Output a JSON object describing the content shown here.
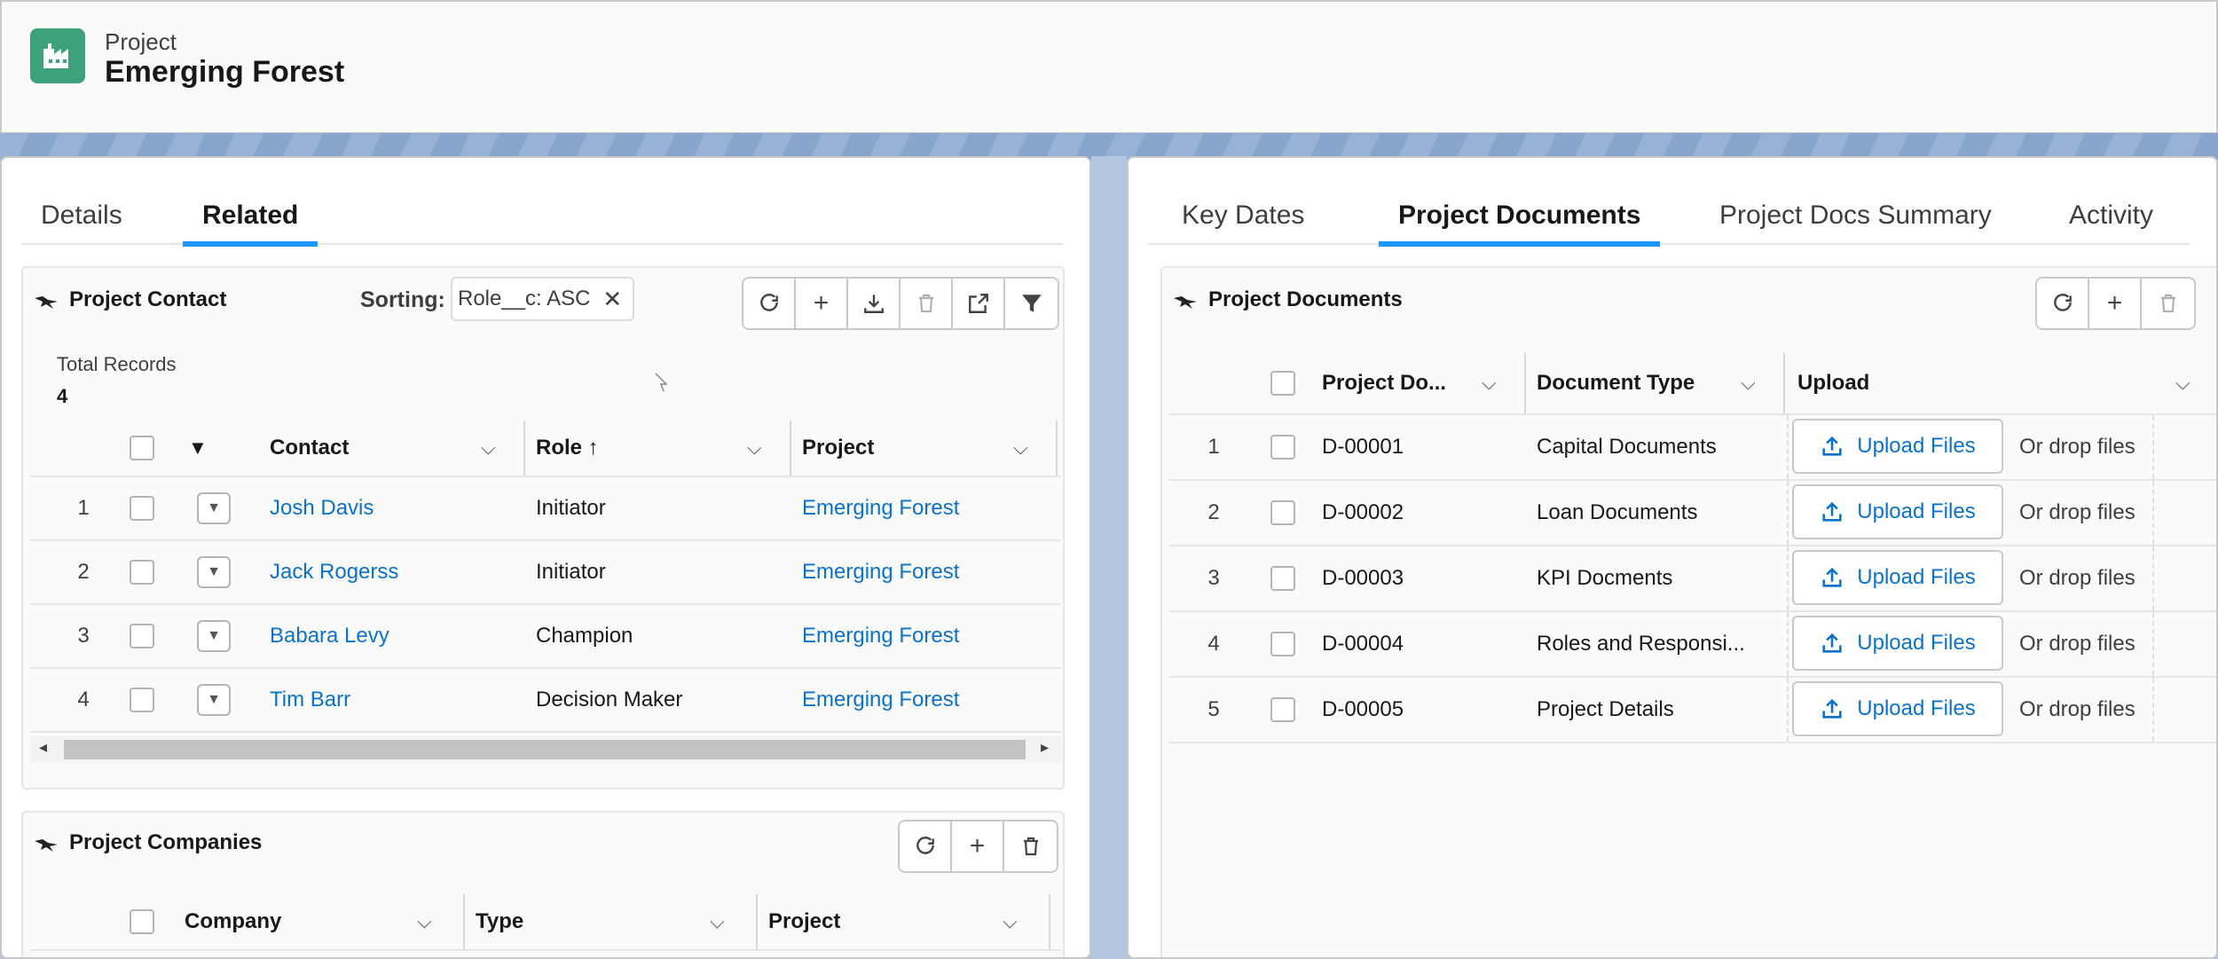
{
  "header": {
    "object_label": "Project",
    "record_name": "Emerging Forest",
    "icon": "factory-icon",
    "icon_color": "#3ba27c"
  },
  "left_panel": {
    "tabs": [
      {
        "label": "Details",
        "active": false
      },
      {
        "label": "Related",
        "active": true
      }
    ],
    "project_contact": {
      "title": "Project Contact",
      "sorting_label": "Sorting:",
      "sorting_value": "Role__c: ASC",
      "actions": [
        "refresh-icon",
        "add-icon",
        "download-icon",
        "delete-icon",
        "open-external-icon",
        "filter-icon"
      ],
      "total_label": "Total Records",
      "total_value": "4",
      "sort_indicator": "▼",
      "columns": [
        "Contact",
        "Role ↑",
        "Project"
      ],
      "rows": [
        {
          "num": "1",
          "contact": "Josh Davis",
          "role": "Initiator",
          "project": "Emerging Forest"
        },
        {
          "num": "2",
          "contact": "Jack Rogerss",
          "role": "Initiator",
          "project": "Emerging Forest"
        },
        {
          "num": "3",
          "contact": "Babara Levy",
          "role": "Champion",
          "project": "Emerging Forest"
        },
        {
          "num": "4",
          "contact": "Tim Barr",
          "role": "Decision Maker",
          "project": "Emerging Forest"
        }
      ]
    },
    "project_companies": {
      "title": "Project Companies",
      "actions": [
        "refresh-icon",
        "add-icon",
        "delete-icon"
      ],
      "columns": [
        "Company",
        "Type",
        "Project"
      ]
    }
  },
  "right_panel": {
    "tabs": [
      {
        "label": "Key Dates",
        "active": false
      },
      {
        "label": "Project Documents",
        "active": true
      },
      {
        "label": "Project Docs Summary",
        "active": false
      },
      {
        "label": "Activity",
        "active": false
      }
    ],
    "project_documents": {
      "title": "Project Documents",
      "actions": [
        "refresh-icon",
        "add-icon",
        "delete-icon"
      ],
      "columns": [
        "Project Do...",
        "Document Type",
        "Upload"
      ],
      "upload_label": "Upload Files",
      "drop_label": "Or drop files",
      "rows": [
        {
          "num": "1",
          "id": "D-00001",
          "type": "Capital Documents"
        },
        {
          "num": "2",
          "id": "D-00002",
          "type": "Loan Documents"
        },
        {
          "num": "3",
          "id": "D-00003",
          "type": "KPI Docments"
        },
        {
          "num": "4",
          "id": "D-00004",
          "type": "Roles and Responsi..."
        },
        {
          "num": "5",
          "id": "D-00005",
          "type": "Project Details"
        }
      ]
    }
  },
  "colors": {
    "link": "#0b72c9",
    "tab_active": "#1b96ff",
    "brand": "#3ba27c"
  }
}
